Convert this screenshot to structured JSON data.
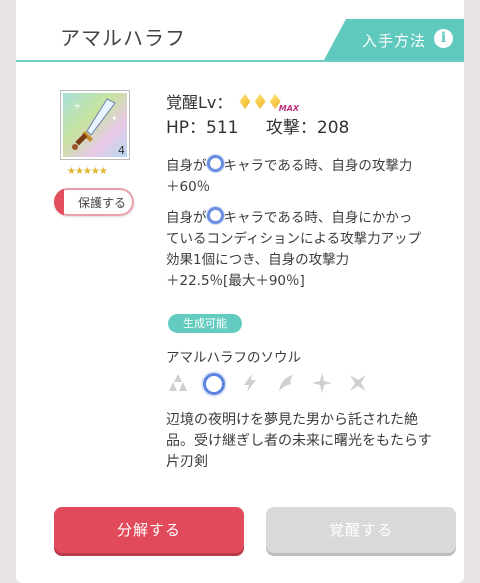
{
  "header": {
    "title": "アマルハラフ",
    "obtain_label": "入手方法",
    "info_icon": "info-icon"
  },
  "weapon": {
    "count": "4",
    "stars": "★★★★★",
    "protect_label": "保護する"
  },
  "awakening": {
    "label": "覚醒Lv：",
    "gems_filled": 3,
    "max_badge": "MAX"
  },
  "stats": {
    "hp": "HP：511",
    "attack": "攻撃：208"
  },
  "abilities": [
    {
      "prefix": "自身が",
      "suffix": "キャラである時、自身の攻撃力",
      "line2": "＋60％"
    },
    {
      "prefix": "自身が",
      "suffix": "キャラである時、自身にかかっ",
      "line2": "ているコンディションによる攻撃力アップ",
      "line3": "効果1個につき、自身の攻撃力",
      "line4": "＋22.5％[最大＋90％]"
    }
  ],
  "craftable_label": "生成可能",
  "soul": {
    "title": "アマルハラフのソウル",
    "icons": [
      "drops-icon",
      "ring-icon-selected",
      "bolt-icon",
      "leaf-icon",
      "sparkle-icon",
      "shuriken-icon"
    ]
  },
  "description": {
    "line1": "辺境の夜明けを夢見た男から託された絶",
    "line2": "品。受け継ぎし者の未来に曙光をもたらす",
    "line3": "片刃剣"
  },
  "buttons": {
    "disassemble": "分解する",
    "awaken": "覚醒する"
  },
  "colors": {
    "teal": "#5fc9bd",
    "red": "#e14a5b",
    "disabled": "#d9d9d9",
    "accent_blue": "#5b84e0"
  }
}
